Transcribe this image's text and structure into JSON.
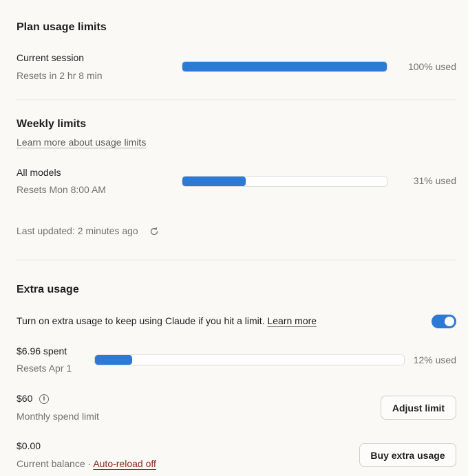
{
  "plan": {
    "title": "Plan usage limits",
    "session": {
      "label": "Current session",
      "reset": "Resets in 2 hr 8 min",
      "percent": 100,
      "percent_label": "100% used"
    }
  },
  "weekly": {
    "title": "Weekly limits",
    "learn_more": "Learn more about usage limits",
    "all_models": {
      "label": "All models",
      "reset": "Resets Mon 8:00 AM",
      "percent": 31,
      "percent_label": "31% used"
    },
    "last_updated": "Last updated: 2 minutes ago",
    "refresh_icon": "refresh-icon"
  },
  "extra": {
    "title": "Extra usage",
    "description": "Turn on extra usage to keep using Claude if you hit a limit.",
    "learn_more": "Learn more",
    "toggle_on": true,
    "spent": {
      "label": "$6.96 spent",
      "reset": "Resets Apr 1",
      "percent": 12,
      "percent_label": "12% used"
    },
    "limit": {
      "amount": "$60",
      "label": "Monthly spend limit",
      "button": "Adjust limit",
      "info_icon": "info-icon"
    },
    "balance": {
      "amount": "$0.00",
      "label": "Current balance",
      "separator": "·",
      "auto_reload": "Auto-reload off",
      "button": "Buy extra usage"
    }
  },
  "colors": {
    "accent": "#2c7ad6",
    "background": "#faf9f5",
    "link_red": "#8a2a22"
  }
}
